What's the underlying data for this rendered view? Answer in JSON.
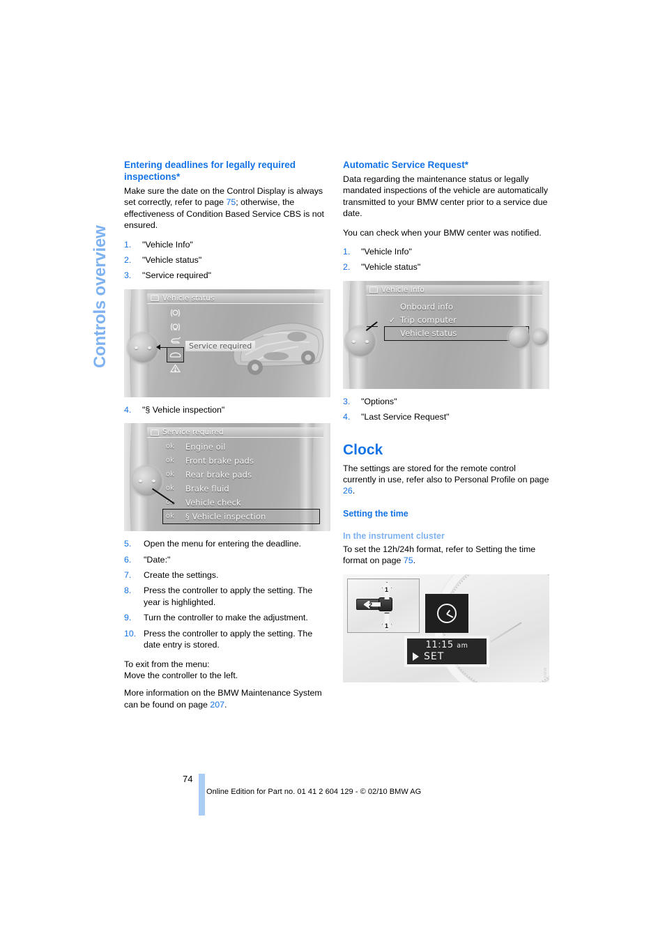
{
  "side_title": "Controls overview",
  "left_column": {
    "section_heading": "Entering deadlines for legally required inspections*",
    "intro_part1": "Make sure the date on the Control Display is always set correctly, refer to page ",
    "intro_ref": "75",
    "intro_part2": "; otherwise, the effectiveness of Condition Based Service CBS is not ensured.",
    "steps_a": [
      {
        "num": "1.",
        "text": "\"Vehicle Info\""
      },
      {
        "num": "2.",
        "text": "\"Vehicle status\""
      },
      {
        "num": "3.",
        "text": "\"Service required\""
      }
    ],
    "step4": {
      "num": "4.",
      "text": "\"§ Vehicle inspection\""
    },
    "steps_b": [
      {
        "num": "5.",
        "text": "Open the menu for entering the deadline."
      },
      {
        "num": "6.",
        "text": "\"Date:\""
      },
      {
        "num": "7.",
        "text": "Create the settings."
      },
      {
        "num": "8.",
        "text": "Press the controller to apply the setting. The year is highlighted."
      },
      {
        "num": "9.",
        "text": "Turn the controller to make the adjustment."
      },
      {
        "num": "10.",
        "text": "Press the controller to apply the setting. The date entry is stored."
      }
    ],
    "exit_note_line1": "To exit from the menu:",
    "exit_note_line2": "Move the controller to the left.",
    "more_info_part1": "More information on the BMW Maintenance System can be found on page ",
    "more_info_ref": "207",
    "more_info_part2": "."
  },
  "right_column": {
    "section_heading": "Automatic Service Request*",
    "para1": "Data regarding the maintenance status or legally mandated inspections of the vehicle are automatically transmitted to your BMW center prior to a service due date.",
    "para2": "You can check when your BMW center was notified.",
    "steps_a": [
      {
        "num": "1.",
        "text": "\"Vehicle Info\""
      },
      {
        "num": "2.",
        "text": "\"Vehicle status\""
      }
    ],
    "steps_b": [
      {
        "num": "3.",
        "text": "\"Options\""
      },
      {
        "num": "4.",
        "text": "\"Last Service Request\""
      }
    ],
    "clock_heading": "Clock",
    "clock_part1": "The settings are stored for the remote control currently in use, refer also to Personal Profile on page ",
    "clock_ref": "26",
    "clock_part2": ".",
    "setting_time_heading": "Setting the time",
    "instrument_cluster_heading": "In the instrument cluster",
    "instrument_part1": "To set the 12h/24h format, refer to Setting the time format on page ",
    "instrument_ref": "75",
    "instrument_part2": "."
  },
  "figure_vehicle_status": {
    "title": "Vehicle status",
    "highlight_label": "Service required",
    "icons": [
      "front-brake-pads-icon",
      "rear-brake-pads-icon",
      "engine-oil-icon",
      "vehicle-inspection-icon",
      "warning-triangle-icon"
    ]
  },
  "figure_vehicle_info": {
    "title": "Vehicle Info",
    "items": [
      {
        "label": "Onboard info",
        "checked": false,
        "selected": false
      },
      {
        "label": "Trip computer",
        "checked": true,
        "selected": false
      },
      {
        "label": "Vehicle status",
        "checked": false,
        "selected": true
      }
    ]
  },
  "figure_service_required": {
    "title": "Service required",
    "status_prefix": "ok",
    "items": [
      {
        "label": "Engine oil",
        "selected": false
      },
      {
        "label": "Front brake pads",
        "selected": false
      },
      {
        "label": "Rear brake pads",
        "selected": false
      },
      {
        "label": "Brake fluid",
        "selected": false
      },
      {
        "label": "Vehicle check",
        "selected": false
      },
      {
        "label": "§ Vehicle inspection",
        "selected": true
      }
    ]
  },
  "figure_instrument_cluster": {
    "time": "11:15",
    "meridiem": "am",
    "set_label": "SET",
    "callout_1": "1",
    "callout_2": "2",
    "clock_icon": "clock-icon"
  },
  "footer": {
    "page_number": "74",
    "text": "Online Edition for Part no. 01 41 2 604 129 - © 02/10 BMW AG"
  },
  "colors": {
    "accent_blue": "#1473e6",
    "light_blue": "#7fb2f0",
    "footer_bar": "#a9cdf5"
  }
}
